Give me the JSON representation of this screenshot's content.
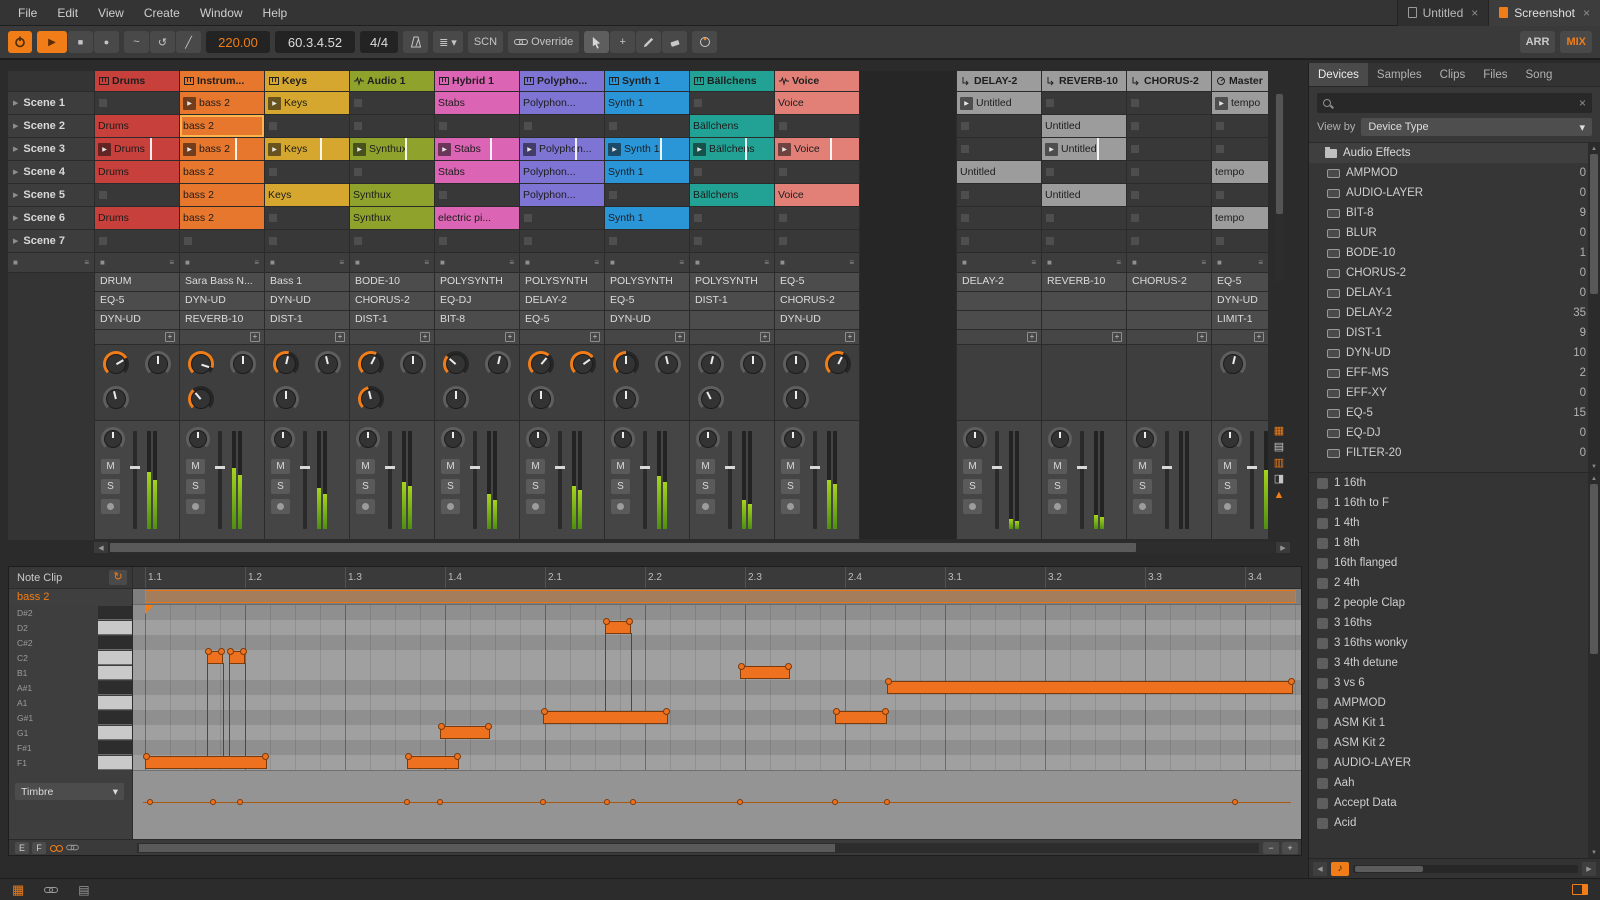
{
  "colors": {
    "accent": "#f07d17",
    "red": "#c8403c",
    "orange": "#e8772e",
    "yellow": "#d5a72f",
    "green": "#8fa32c",
    "pink": "#dc64b4",
    "purple": "#7e74d4",
    "blue": "#2a96d8",
    "teal": "#21a295",
    "salmon": "#e28078",
    "gray": "#9c9c9c"
  },
  "icons": {
    "play": "▶",
    "stop": "■",
    "record": "●",
    "close": "×",
    "caret_down": "▾",
    "loop": "↺",
    "line": "╱",
    "wave": "~",
    "plus": "+",
    "minus": "−",
    "arrow_left": "◀",
    "arrow_right": "▶",
    "arrow_up": "▲",
    "arrow_down": "▼",
    "note": "♪",
    "menu_bars": "≣",
    "meter_bars": "≡",
    "loop_editor": "↻",
    "pads": "▦",
    "package": "▤"
  },
  "menubar": {
    "menus": [
      "File",
      "Edit",
      "View",
      "Create",
      "Window",
      "Help"
    ],
    "window_tabs": [
      {
        "label": "Untitled",
        "active": false
      },
      {
        "label": "Screenshot",
        "active": true
      }
    ]
  },
  "transport": {
    "tempo": "220.00",
    "position": "60.3.4.52",
    "time_signature": "4/4",
    "scn_label": "SCN",
    "override_label": "Override",
    "arr_label": "ARR",
    "mix_label": "MIX"
  },
  "mixer": {
    "mute_label": "M",
    "solo_label": "S"
  },
  "side_strip": [
    {
      "name": "grid-view-icon",
      "glyph": "▦",
      "accent": true
    },
    {
      "name": "list-view-icon",
      "glyph": "▤",
      "accent": false
    },
    {
      "name": "notes-view-icon",
      "glyph": "▥",
      "accent": true
    },
    {
      "name": "device-view-icon",
      "glyph": "◨",
      "accent": false
    },
    {
      "name": "io-view-icon",
      "glyph": "▲",
      "accent": true
    }
  ],
  "session": {
    "scenes": [
      "Scene 1",
      "Scene 2",
      "Scene 3",
      "Scene 4",
      "Scene 5",
      "Scene 6",
      "Scene 7"
    ],
    "tracks": [
      {
        "name": "Drums",
        "color": "red",
        "type": "instrument",
        "devices": [
          "DRUM",
          "EQ-5",
          "DYN-UD"
        ],
        "knobs": [
          {
            "v": 0.72,
            "arc": true
          },
          {
            "v": 0.5,
            "arc": false
          },
          {
            "v": 0.45,
            "arc": false
          }
        ],
        "meter": [
          58,
          50
        ],
        "clips": [
          null,
          {
            "label": "Drums"
          },
          {
            "label": "Drums",
            "arrow": true,
            "playing": true
          },
          {
            "label": "Drums"
          },
          null,
          {
            "label": "Drums"
          },
          null
        ]
      },
      {
        "name": "Instrum...",
        "color": "orange",
        "type": "instrument",
        "devices": [
          "Sara Bass N...",
          "DYN-UD",
          "REVERB-10"
        ],
        "knobs": [
          {
            "v": 0.9,
            "arc": true
          },
          {
            "v": 0.5,
            "arc": false
          },
          {
            "v": 0.35,
            "arc": true
          }
        ],
        "meter": [
          62,
          55
        ],
        "clips": [
          {
            "label": "bass 2",
            "arrow": true
          },
          {
            "label": "bass 2",
            "selected": true
          },
          {
            "label": "bass 2",
            "arrow": true,
            "playing": true
          },
          {
            "label": "bass 2"
          },
          {
            "label": "bass 2"
          },
          {
            "label": "bass 2"
          },
          null
        ]
      },
      {
        "name": "Keys",
        "color": "yellow",
        "type": "instrument",
        "devices": [
          "Bass 1",
          "DYN-UD",
          "DIST-1"
        ],
        "knobs": [
          {
            "v": 0.55,
            "arc": true
          },
          {
            "v": 0.45,
            "arc": false
          },
          {
            "v": 0.5,
            "arc": false
          }
        ],
        "meter": [
          42,
          36
        ],
        "clips": [
          {
            "label": "Keys",
            "arrow": true
          },
          null,
          {
            "label": "Keys",
            "arrow": true,
            "playing": true
          },
          null,
          {
            "label": "Keys"
          },
          null,
          null
        ]
      },
      {
        "name": "Audio 1",
        "color": "green",
        "type": "audio",
        "devices": [
          "BODE-10",
          "CHORUS-2",
          "DIST-1"
        ],
        "knobs": [
          {
            "v": 0.6,
            "arc": true
          },
          {
            "v": 0.5,
            "arc": false
          },
          {
            "v": 0.45,
            "arc": true
          }
        ],
        "meter": [
          48,
          44
        ],
        "clips": [
          null,
          null,
          {
            "label": "Synthux",
            "arrow": true,
            "playing": true
          },
          null,
          {
            "label": "Synthux"
          },
          {
            "label": "Synthux"
          },
          null
        ]
      },
      {
        "name": "Hybrid 1",
        "color": "pink",
        "type": "instrument",
        "devices": [
          "POLYSYNTH",
          "EQ-DJ",
          "BIT-8"
        ],
        "knobs": [
          {
            "v": 0.32,
            "arc": true
          },
          {
            "v": 0.55,
            "arc": false
          },
          {
            "v": 0.5,
            "arc": false
          }
        ],
        "meter": [
          36,
          30
        ],
        "clips": [
          {
            "label": "Stabs"
          },
          null,
          {
            "label": "Stabs",
            "arrow": true,
            "playing": true
          },
          {
            "label": "Stabs"
          },
          null,
          {
            "label": "electric pi..."
          },
          null
        ]
      },
      {
        "name": "Polypho...",
        "color": "purple",
        "type": "instrument",
        "devices": [
          "POLYSYNTH",
          "DELAY-2",
          "EQ-5"
        ],
        "knobs": [
          {
            "v": 0.65,
            "arc": true
          },
          {
            "v": 0.7,
            "arc": true
          },
          {
            "v": 0.5,
            "arc": false
          }
        ],
        "meter": [
          44,
          40
        ],
        "clips": [
          {
            "label": "Polyphon..."
          },
          null,
          {
            "label": "Polyphon...",
            "arrow": true,
            "playing": true
          },
          {
            "label": "Polyphon..."
          },
          {
            "label": "Polyphon..."
          },
          null,
          null
        ]
      },
      {
        "name": "Synth 1",
        "color": "blue",
        "type": "instrument",
        "devices": [
          "POLYSYNTH",
          "EQ-5",
          "DYN-UD"
        ],
        "knobs": [
          {
            "v": 0.5,
            "arc": true
          },
          {
            "v": 0.45,
            "arc": false
          },
          {
            "v": 0.5,
            "arc": false
          }
        ],
        "meter": [
          54,
          48
        ],
        "clips": [
          {
            "label": "Synth 1"
          },
          null,
          {
            "label": "Synth 1",
            "arrow": true,
            "playing": true
          },
          {
            "label": "Synth 1"
          },
          null,
          {
            "label": "Synth 1"
          },
          null
        ]
      },
      {
        "name": "Bällchens",
        "color": "teal",
        "type": "instrument",
        "devices": [
          "POLYSYNTH",
          "DIST-1",
          ""
        ],
        "knobs": [
          {
            "v": 0.55,
            "arc": false
          },
          {
            "v": 0.5,
            "arc": false
          },
          {
            "v": 0.4,
            "arc": false
          }
        ],
        "meter": [
          30,
          26
        ],
        "clips": [
          null,
          {
            "label": "Bällchens"
          },
          {
            "label": "Bällchens",
            "arrow": true,
            "playing": true
          },
          null,
          {
            "label": "Bällchens"
          },
          null,
          null
        ]
      },
      {
        "name": "Voice",
        "color": "salmon",
        "type": "audio",
        "gap_after": true,
        "devices": [
          "EQ-5",
          "CHORUS-2",
          "DYN-UD"
        ],
        "knobs": [
          {
            "v": 0.5,
            "arc": false
          },
          {
            "v": 0.6,
            "arc": true
          },
          {
            "v": 0.5,
            "arc": false
          }
        ],
        "meter": [
          50,
          46
        ],
        "clips": [
          {
            "label": "Voice"
          },
          null,
          {
            "label": "Voice",
            "arrow": true,
            "playing": true
          },
          null,
          {
            "label": "Voice"
          },
          null,
          null
        ]
      },
      {
        "name": "DELAY-2",
        "color": "gray",
        "type": "fx",
        "devices": [
          "DELAY-2",
          "",
          ""
        ],
        "knobs": [],
        "meter": [
          10,
          8
        ],
        "clips": [
          {
            "label": "Untitled",
            "color": "gray",
            "arrow": true
          },
          null,
          null,
          {
            "label": "Untitled",
            "color": "gray"
          },
          null,
          null,
          null
        ]
      },
      {
        "name": "REVERB-10",
        "color": "gray",
        "type": "fx",
        "devices": [
          "REVERB-10",
          "",
          ""
        ],
        "knobs": [],
        "meter": [
          14,
          12
        ],
        "clips": [
          null,
          {
            "label": "Untitled",
            "color": "gray"
          },
          {
            "label": "Untitled",
            "color": "gray",
            "arrow": true,
            "playing": true
          },
          null,
          {
            "label": "Untitled",
            "color": "gray"
          },
          null,
          null
        ]
      },
      {
        "name": "CHORUS-2",
        "color": "gray",
        "type": "fx",
        "devices": [
          "CHORUS-2",
          "",
          ""
        ],
        "knobs": [],
        "meter": [
          0,
          0
        ],
        "clips": [
          null,
          null,
          null,
          null,
          null,
          null,
          null
        ]
      },
      {
        "name": "Master",
        "color": "gray",
        "type": "master",
        "devices": [
          "EQ-5",
          "DYN-UD",
          "LIMIT-1"
        ],
        "knobs": [
          {
            "v": 0.55,
            "arc": false
          }
        ],
        "meter": [
          60,
          56
        ],
        "clips": [
          {
            "label": "tempo",
            "color": "gray",
            "arrow": true
          },
          null,
          null,
          {
            "label": "tempo",
            "color": "gray"
          },
          null,
          {
            "label": "tempo",
            "color": "gray"
          },
          null
        ]
      }
    ]
  },
  "browser": {
    "tabs": [
      "Devices",
      "Samples",
      "Clips",
      "Files",
      "Song"
    ],
    "active_tab": "Devices",
    "view_by_label": "View by",
    "view_by_value": "Device Type",
    "folder_label": "Audio Effects",
    "devices": [
      {
        "name": "AMPMOD",
        "count": "0"
      },
      {
        "name": "AUDIO-LAYER",
        "count": "0"
      },
      {
        "name": "BIT-8",
        "count": "9"
      },
      {
        "name": "BLUR",
        "count": "0"
      },
      {
        "name": "BODE-10",
        "count": "1"
      },
      {
        "name": "CHORUS-2",
        "count": "0"
      },
      {
        "name": "DELAY-1",
        "count": "0"
      },
      {
        "name": "DELAY-2",
        "count": "35"
      },
      {
        "name": "DIST-1",
        "count": "9"
      },
      {
        "name": "DYN-UD",
        "count": "10"
      },
      {
        "name": "EFF-MS",
        "count": "2"
      },
      {
        "name": "EFF-XY",
        "count": "0"
      },
      {
        "name": "EQ-5",
        "count": "15"
      },
      {
        "name": "EQ-DJ",
        "count": "0"
      },
      {
        "name": "FILTER-20",
        "count": "0"
      }
    ],
    "presets": [
      "1 16th",
      "1 16th to F",
      "1 4th",
      "1 8th",
      "16th flanged",
      "2 4th",
      "2 people Clap",
      "3 16ths",
      "3 16ths wonky",
      "3 4th detune",
      "3 vs 6",
      "AMPMOD",
      "ASM Kit 1",
      "ASM Kit 2",
      "AUDIO-LAYER",
      "Aah",
      "Accept Data",
      "Acid"
    ]
  },
  "editor": {
    "title": "Note Clip",
    "clip_name": "bass 2",
    "ruler": [
      "1.1",
      "1.2",
      "1.3",
      "1.4",
      "2.1",
      "2.2",
      "2.3",
      "2.4",
      "3.1",
      "3.2",
      "3.3",
      "3.4"
    ],
    "pitches": [
      {
        "label": "D#2",
        "sharp": true
      },
      {
        "label": "D2",
        "sharp": false
      },
      {
        "label": "C#2",
        "sharp": true
      },
      {
        "label": "C2",
        "sharp": false
      },
      {
        "label": "B1",
        "sharp": false
      },
      {
        "label": "A#1",
        "sharp": true
      },
      {
        "label": "A1",
        "sharp": false
      },
      {
        "label": "G#1",
        "sharp": true
      },
      {
        "label": "G1",
        "sharp": false
      },
      {
        "label": "F#1",
        "sharp": true
      },
      {
        "label": "F1",
        "sharp": false
      }
    ],
    "notes": [
      {
        "pitch": "F1",
        "start": 0.0,
        "len": 1.22
      },
      {
        "pitch": "C2",
        "start": 0.62,
        "len": 0.16
      },
      {
        "pitch": "C2",
        "start": 0.84,
        "len": 0.16
      },
      {
        "pitch": "F1",
        "start": 2.62,
        "len": 0.52
      },
      {
        "pitch": "G1",
        "start": 2.95,
        "len": 0.5
      },
      {
        "pitch": "G#1",
        "start": 3.98,
        "len": 1.25
      },
      {
        "pitch": "D2",
        "start": 4.6,
        "len": 0.26
      },
      {
        "pitch": "B1",
        "start": 5.95,
        "len": 0.5
      },
      {
        "pitch": "G#1",
        "start": 6.9,
        "len": 0.52
      },
      {
        "pitch": "A#1",
        "start": 7.42,
        "len": 4.06
      }
    ],
    "note_links": [
      {
        "from": "C2",
        "to": "F1",
        "beats": [
          0.62,
          0.78,
          0.84,
          1.0
        ]
      },
      {
        "from": "D2",
        "to": "G#1",
        "beats": [
          4.6,
          4.86
        ]
      }
    ],
    "expression_selector": "Timbre",
    "mode_buttons": [
      "E",
      "F"
    ],
    "expression_points": [
      0.05,
      0.68,
      0.95,
      2.62,
      2.95,
      3.98,
      4.62,
      4.88,
      5.95,
      6.9,
      7.42,
      10.9
    ]
  }
}
